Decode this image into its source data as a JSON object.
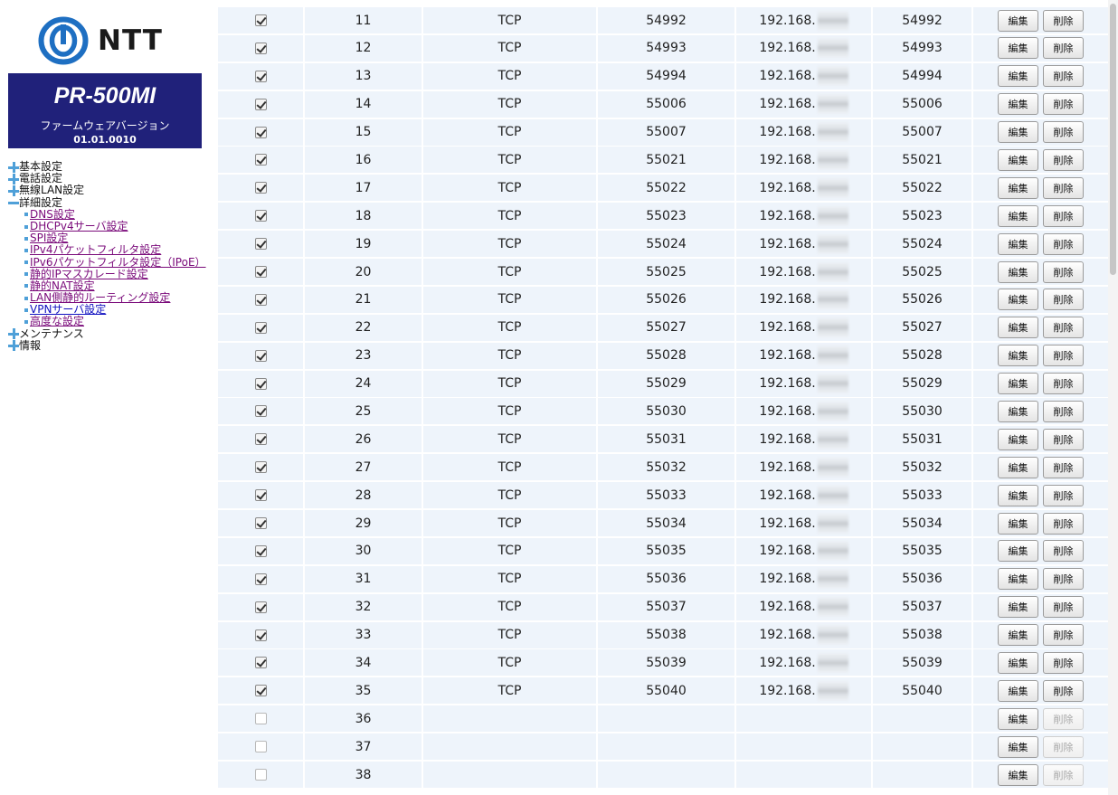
{
  "brand": {
    "logo_text": "NTT",
    "model": "PR-500MI",
    "firmware_label": "ファームウェアバージョン",
    "firmware_version": "01.01.0010"
  },
  "nav": {
    "items": [
      {
        "label": "基本設定",
        "state": "collapsed"
      },
      {
        "label": "電話設定",
        "state": "collapsed"
      },
      {
        "label": "無線LAN設定",
        "state": "collapsed"
      },
      {
        "label": "詳細設定",
        "state": "expanded"
      }
    ],
    "sub_items": [
      {
        "label": "DNS設定"
      },
      {
        "label": "DHCPv4サーバ設定"
      },
      {
        "label": "SPI設定"
      },
      {
        "label": "IPv4パケットフィルタ設定"
      },
      {
        "label": "IPv6パケットフィルタ設定（IPoE）"
      },
      {
        "label": "静的IPマスカレード設定"
      },
      {
        "label": "静的NAT設定"
      },
      {
        "label": "LAN側静的ルーティング設定"
      },
      {
        "label": "VPNサーバ設定"
      },
      {
        "label": "高度な設定"
      }
    ],
    "bottom_items": [
      {
        "label": "メンテナンス",
        "state": "collapsed"
      },
      {
        "label": "情報",
        "state": "collapsed"
      }
    ]
  },
  "table": {
    "edit_label": "編集",
    "delete_label": "削除",
    "rows": [
      {
        "enabled": true,
        "no": "11",
        "protocol": "TCP",
        "port": "54992",
        "ip": "192.168.",
        "lan_port": "54992"
      },
      {
        "enabled": true,
        "no": "12",
        "protocol": "TCP",
        "port": "54993",
        "ip": "192.168.",
        "lan_port": "54993"
      },
      {
        "enabled": true,
        "no": "13",
        "protocol": "TCP",
        "port": "54994",
        "ip": "192.168.",
        "lan_port": "54994"
      },
      {
        "enabled": true,
        "no": "14",
        "protocol": "TCP",
        "port": "55006",
        "ip": "192.168.",
        "lan_port": "55006"
      },
      {
        "enabled": true,
        "no": "15",
        "protocol": "TCP",
        "port": "55007",
        "ip": "192.168.",
        "lan_port": "55007"
      },
      {
        "enabled": true,
        "no": "16",
        "protocol": "TCP",
        "port": "55021",
        "ip": "192.168.",
        "lan_port": "55021"
      },
      {
        "enabled": true,
        "no": "17",
        "protocol": "TCP",
        "port": "55022",
        "ip": "192.168.",
        "lan_port": "55022"
      },
      {
        "enabled": true,
        "no": "18",
        "protocol": "TCP",
        "port": "55023",
        "ip": "192.168.",
        "lan_port": "55023"
      },
      {
        "enabled": true,
        "no": "19",
        "protocol": "TCP",
        "port": "55024",
        "ip": "192.168.",
        "lan_port": "55024"
      },
      {
        "enabled": true,
        "no": "20",
        "protocol": "TCP",
        "port": "55025",
        "ip": "192.168.",
        "lan_port": "55025"
      },
      {
        "enabled": true,
        "no": "21",
        "protocol": "TCP",
        "port": "55026",
        "ip": "192.168.",
        "lan_port": "55026"
      },
      {
        "enabled": true,
        "no": "22",
        "protocol": "TCP",
        "port": "55027",
        "ip": "192.168.",
        "lan_port": "55027"
      },
      {
        "enabled": true,
        "no": "23",
        "protocol": "TCP",
        "port": "55028",
        "ip": "192.168.",
        "lan_port": "55028"
      },
      {
        "enabled": true,
        "no": "24",
        "protocol": "TCP",
        "port": "55029",
        "ip": "192.168.",
        "lan_port": "55029"
      },
      {
        "enabled": true,
        "no": "25",
        "protocol": "TCP",
        "port": "55030",
        "ip": "192.168.",
        "lan_port": "55030"
      },
      {
        "enabled": true,
        "no": "26",
        "protocol": "TCP",
        "port": "55031",
        "ip": "192.168.",
        "lan_port": "55031"
      },
      {
        "enabled": true,
        "no": "27",
        "protocol": "TCP",
        "port": "55032",
        "ip": "192.168.",
        "lan_port": "55032"
      },
      {
        "enabled": true,
        "no": "28",
        "protocol": "TCP",
        "port": "55033",
        "ip": "192.168.",
        "lan_port": "55033"
      },
      {
        "enabled": true,
        "no": "29",
        "protocol": "TCP",
        "port": "55034",
        "ip": "192.168.",
        "lan_port": "55034"
      },
      {
        "enabled": true,
        "no": "30",
        "protocol": "TCP",
        "port": "55035",
        "ip": "192.168.",
        "lan_port": "55035"
      },
      {
        "enabled": true,
        "no": "31",
        "protocol": "TCP",
        "port": "55036",
        "ip": "192.168.",
        "lan_port": "55036"
      },
      {
        "enabled": true,
        "no": "32",
        "protocol": "TCP",
        "port": "55037",
        "ip": "192.168.",
        "lan_port": "55037"
      },
      {
        "enabled": true,
        "no": "33",
        "protocol": "TCP",
        "port": "55038",
        "ip": "192.168.",
        "lan_port": "55038"
      },
      {
        "enabled": true,
        "no": "34",
        "protocol": "TCP",
        "port": "55039",
        "ip": "192.168.",
        "lan_port": "55039"
      },
      {
        "enabled": true,
        "no": "35",
        "protocol": "TCP",
        "port": "55040",
        "ip": "192.168.",
        "lan_port": "55040"
      },
      {
        "enabled": false,
        "no": "36",
        "protocol": "",
        "port": "",
        "ip": "",
        "lan_port": ""
      },
      {
        "enabled": false,
        "no": "37",
        "protocol": "",
        "port": "",
        "ip": "",
        "lan_port": ""
      },
      {
        "enabled": false,
        "no": "38",
        "protocol": "",
        "port": "",
        "ip": "",
        "lan_port": ""
      }
    ]
  },
  "colors": {
    "brand_navy": "#20217a",
    "accent_blue": "#4fa0d8",
    "visited_link": "#7a0a7a",
    "row_bg": "#eef4fb"
  }
}
